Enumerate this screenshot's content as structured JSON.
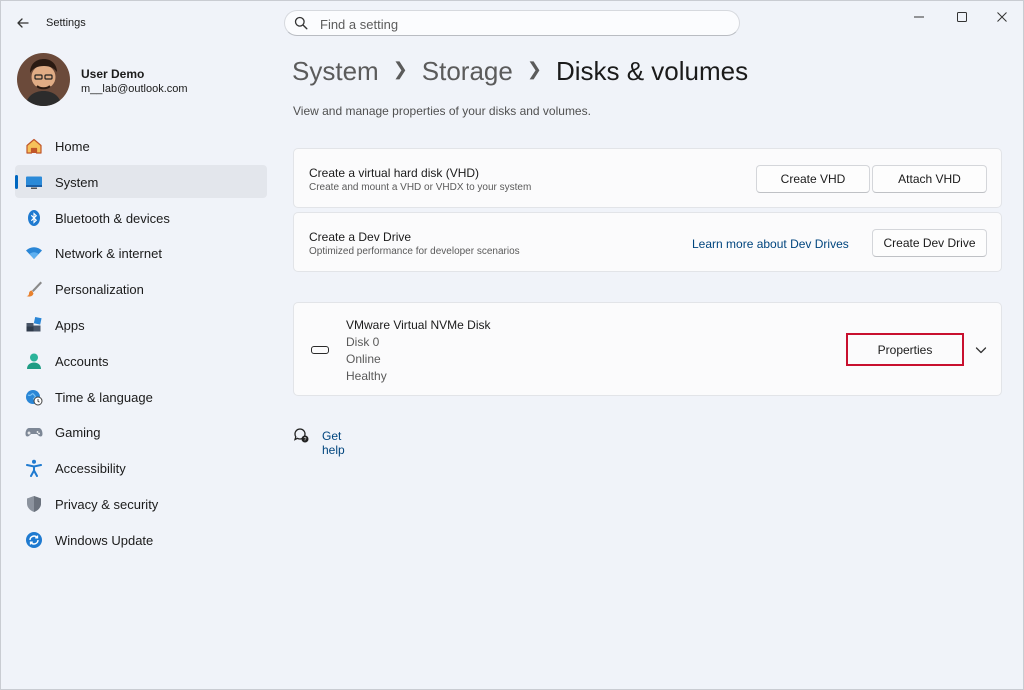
{
  "window": {
    "title": "Settings"
  },
  "search": {
    "placeholder": "Find a setting"
  },
  "profile": {
    "name": "User Demo",
    "email": "m__lab@outlook.com"
  },
  "sidebar": {
    "items": [
      {
        "label": "Home",
        "icon": "home-icon"
      },
      {
        "label": "System",
        "icon": "system-icon",
        "active": true
      },
      {
        "label": "Bluetooth & devices",
        "icon": "bluetooth-icon"
      },
      {
        "label": "Network & internet",
        "icon": "wifi-icon"
      },
      {
        "label": "Personalization",
        "icon": "brush-icon"
      },
      {
        "label": "Apps",
        "icon": "apps-icon"
      },
      {
        "label": "Accounts",
        "icon": "accounts-icon"
      },
      {
        "label": "Time & language",
        "icon": "globe-clock-icon"
      },
      {
        "label": "Gaming",
        "icon": "gamepad-icon"
      },
      {
        "label": "Accessibility",
        "icon": "accessibility-icon"
      },
      {
        "label": "Privacy & security",
        "icon": "shield-icon"
      },
      {
        "label": "Windows Update",
        "icon": "update-icon"
      }
    ]
  },
  "breadcrumb": {
    "items": [
      "System",
      "Storage"
    ],
    "current": "Disks & volumes"
  },
  "main": {
    "subtitle": "View and manage properties of your disks and volumes.",
    "vhd_card": {
      "title": "Create a virtual hard disk (VHD)",
      "description": "Create and mount a VHD or VHDX to your system",
      "create_label": "Create VHD",
      "attach_label": "Attach VHD"
    },
    "dev_drive_card": {
      "title": "Create a Dev Drive",
      "description": "Optimized performance for developer scenarios",
      "link_label": "Learn more about Dev Drives",
      "button_label": "Create Dev Drive"
    },
    "disk_card": {
      "name": "VMware Virtual NVMe Disk",
      "disk": "Disk 0",
      "status": "Online",
      "health": "Healthy",
      "properties_label": "Properties"
    },
    "help_label": "Get help"
  },
  "colors": {
    "accent": "#0067c0",
    "highlight": "#c8102e",
    "link": "#00457e",
    "background": "#eef1f7"
  }
}
